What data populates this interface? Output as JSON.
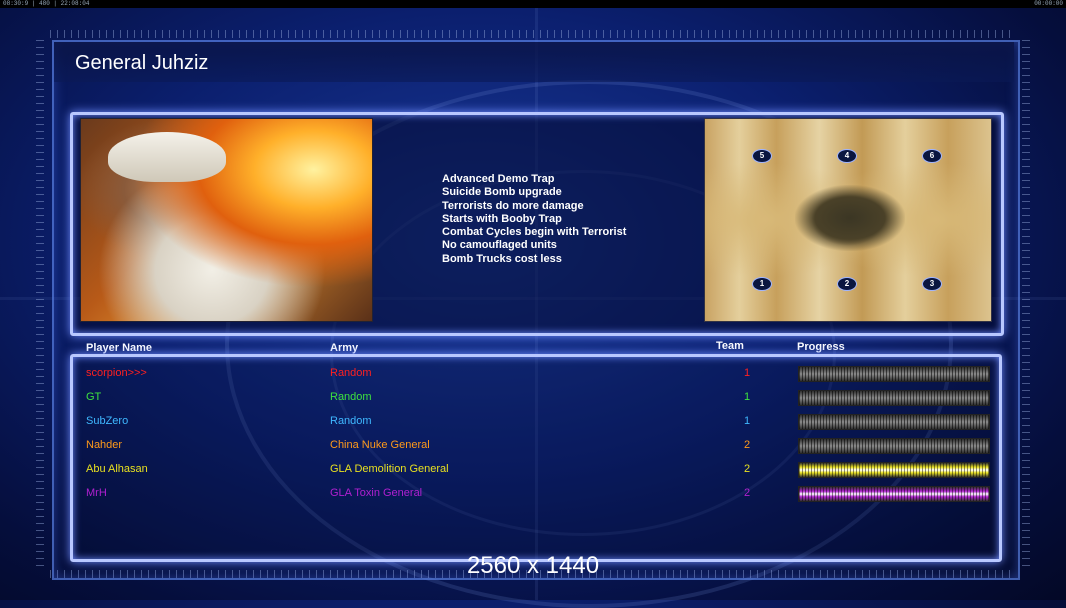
{
  "status_bar": {
    "left": "08:30:9 | 480 | 22:08:04",
    "right": "00:00:00"
  },
  "general": {
    "title": "General Juhziz"
  },
  "bonuses": [
    "Advanced Demo Trap",
    "Suicide Bomb upgrade",
    "Terrorists do more damage",
    "Starts with Booby Trap",
    "Combat Cycles begin with Terrorist",
    "No camouflaged units",
    "Bomb Trucks cost less"
  ],
  "minimap": {
    "spawns": [
      "5",
      "4",
      "6",
      "1",
      "2",
      "3"
    ]
  },
  "table": {
    "headers": {
      "name": "Player Name",
      "army": "Army",
      "team": "Team",
      "progress": "Progress"
    },
    "players": [
      {
        "name": "scorpion>>>",
        "army": "Random",
        "team": "1",
        "color": "#ff2020",
        "progress": 0.0
      },
      {
        "name": "GT",
        "army": "Random",
        "team": "1",
        "color": "#3ee23e",
        "progress": 0.0
      },
      {
        "name": "SubZero",
        "army": "Random",
        "team": "1",
        "color": "#3fb8ff",
        "progress": 0.0
      },
      {
        "name": "Nahder",
        "army": "China Nuke General",
        "team": "2",
        "color": "#ff9a1a",
        "progress": 0.0
      },
      {
        "name": "Abu Alhasan",
        "army": "GLA Demolition General",
        "team": "2",
        "color": "#e8e020",
        "progress": 1.0
      },
      {
        "name": "MrH",
        "army": "GLA Toxin General",
        "team": "2",
        "color": "#b020d0",
        "progress": 1.0
      }
    ]
  },
  "overlay": {
    "resolution": "2560 x 1440"
  }
}
